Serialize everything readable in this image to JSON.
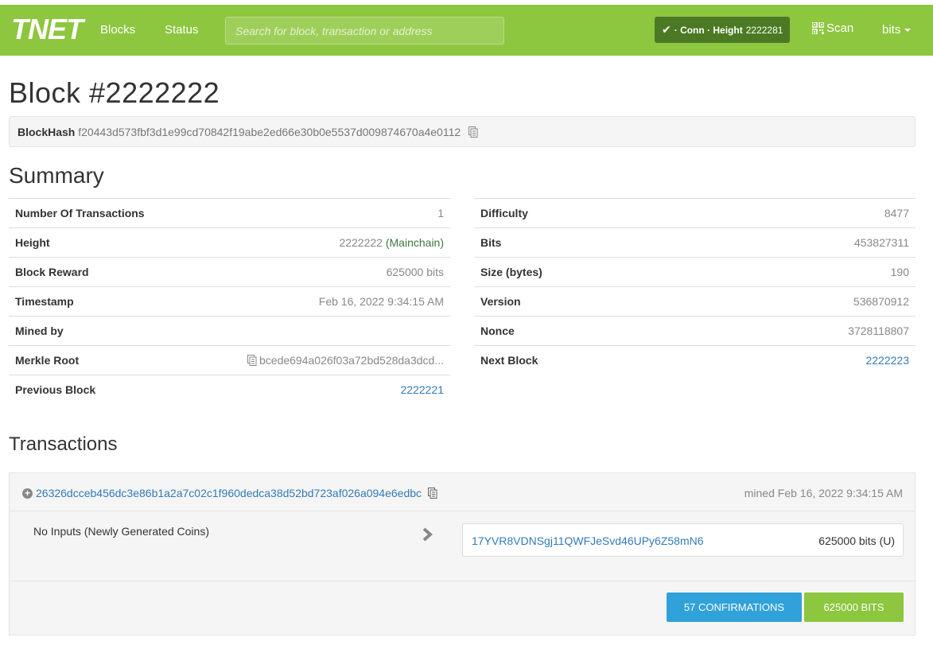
{
  "navbar": {
    "brand": "TNET",
    "links": [
      "Blocks",
      "Status"
    ],
    "search_placeholder": "Search for block, transaction or address",
    "conn_label": "· Conn · Height",
    "height": "2222281",
    "scan_label": "Scan",
    "units_label": "bits",
    "accent_color": "#8dc63f"
  },
  "block": {
    "title": "Block #2222222",
    "hash_label": "BlockHash",
    "hash": "f20443d573fbf3d1e99cd70842f19abe2ed66e30b0e5537d009874670a4e0112"
  },
  "summary": {
    "heading": "Summary",
    "left": [
      {
        "label": "Number Of Transactions",
        "value": "1"
      },
      {
        "label": "Height",
        "value": "2222222",
        "note": "(Mainchain)"
      },
      {
        "label": "Block Reward",
        "value": "625000 bits"
      },
      {
        "label": "Timestamp",
        "value": "Feb 16, 2022 9:34:15 AM"
      },
      {
        "label": "Mined by",
        "value": ""
      },
      {
        "label": "Merkle Root",
        "value": "bcede694a026f03a72bd528da3dcd..."
      },
      {
        "label": "Previous Block",
        "value": "2222221"
      }
    ],
    "right": [
      {
        "label": "Difficulty",
        "value": "8477"
      },
      {
        "label": "Bits",
        "value": "453827311"
      },
      {
        "label": "Size (bytes)",
        "value": "190"
      },
      {
        "label": "Version",
        "value": "536870912"
      },
      {
        "label": "Nonce",
        "value": "3728118807"
      },
      {
        "label": "Next Block",
        "value": "2222223"
      }
    ]
  },
  "transactions": {
    "heading": "Transactions",
    "tx": {
      "txid": "26326dcceb456dc3e86b1a2a7c02c1f960dedca38d52bd723af026a094e6edbc",
      "mined": "mined Feb 16, 2022 9:34:15 AM",
      "inputs_text": "No Inputs (Newly Generated Coins)",
      "output_address": "17YVR8VDNSgj11QWFJeSvd46UPy6Z58mN6",
      "output_amount": "625000 bits (U)",
      "confirmations": "57 CONFIRMATIONS",
      "total": "625000 BITS"
    }
  }
}
